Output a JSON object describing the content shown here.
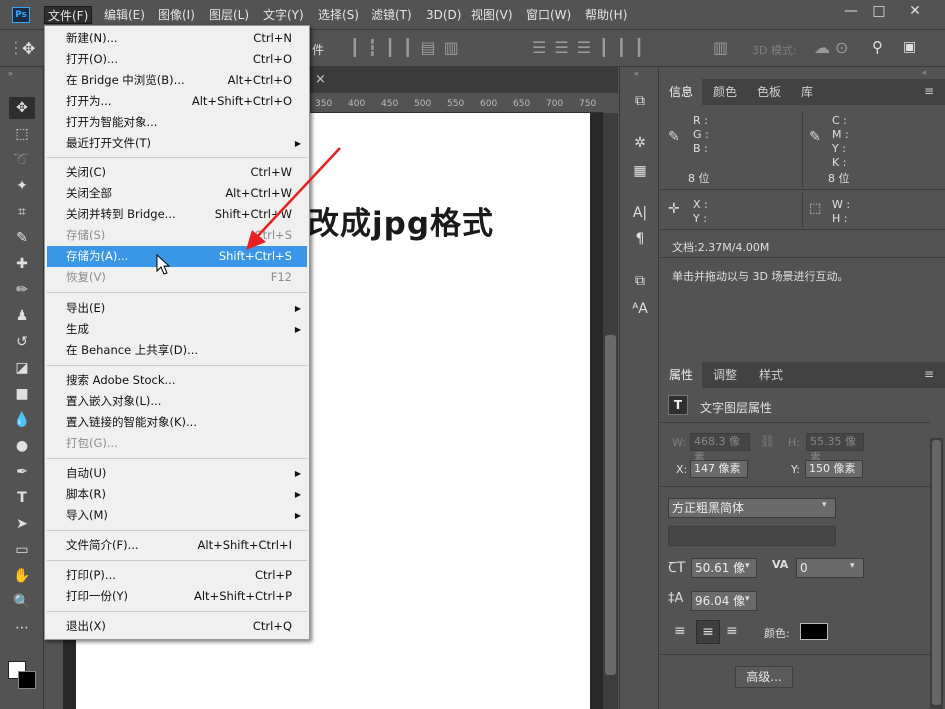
{
  "app": {
    "logo": "Ps"
  },
  "menubar": {
    "items": [
      {
        "label": "文件(F)",
        "active": true
      },
      {
        "label": "编辑(E)"
      },
      {
        "label": "图像(I)"
      },
      {
        "label": "图层(L)"
      },
      {
        "label": "文字(Y)"
      },
      {
        "label": "选择(S)"
      },
      {
        "label": "滤镜(T)"
      },
      {
        "label": "3D(D)"
      },
      {
        "label": "视图(V)"
      },
      {
        "label": "窗口(W)"
      },
      {
        "label": "帮助(H)"
      }
    ],
    "window_controls": [
      "minimize-icon",
      "maximize-icon",
      "close-icon"
    ]
  },
  "options_bar": {
    "partial_label": "件",
    "mode_label": "3D 模式:"
  },
  "document": {
    "tab_close": "×",
    "ruler_ticks": [
      "350",
      "400",
      "450",
      "500",
      "550",
      "600",
      "650",
      "700",
      "750"
    ],
    "canvas_text": "改成jpg格式"
  },
  "file_menu": {
    "items": [
      {
        "label": "新建(N)...",
        "shortcut": "Ctrl+N"
      },
      {
        "label": "打开(O)...",
        "shortcut": "Ctrl+O"
      },
      {
        "label": "在 Bridge 中浏览(B)...",
        "shortcut": "Alt+Ctrl+O"
      },
      {
        "label": "打开为...",
        "shortcut": "Alt+Shift+Ctrl+O"
      },
      {
        "label": "打开为智能对象...",
        "shortcut": ""
      },
      {
        "label": "最近打开文件(T)",
        "shortcut": "",
        "submenu": true
      },
      {
        "label": "关闭(C)",
        "shortcut": "Ctrl+W"
      },
      {
        "label": "关闭全部",
        "shortcut": "Alt+Ctrl+W"
      },
      {
        "label": "关闭并转到 Bridge...",
        "shortcut": "Shift+Ctrl+W"
      },
      {
        "label": "存储(S)",
        "shortcut": "Ctrl+S",
        "disabled": true
      },
      {
        "label": "存储为(A)...",
        "shortcut": "Shift+Ctrl+S",
        "highlighted": true
      },
      {
        "label": "恢复(V)",
        "shortcut": "F12",
        "disabled": true
      },
      {
        "label": "导出(E)",
        "shortcut": "",
        "submenu": true
      },
      {
        "label": "生成",
        "shortcut": "",
        "submenu": true
      },
      {
        "label": "在 Behance 上共享(D)...",
        "shortcut": ""
      },
      {
        "label": "搜索 Adobe Stock...",
        "shortcut": ""
      },
      {
        "label": "置入嵌入对象(L)...",
        "shortcut": ""
      },
      {
        "label": "置入链接的智能对象(K)...",
        "shortcut": ""
      },
      {
        "label": "打包(G)...",
        "shortcut": "",
        "disabled": true
      },
      {
        "label": "自动(U)",
        "shortcut": "",
        "submenu": true
      },
      {
        "label": "脚本(R)",
        "shortcut": "",
        "submenu": true
      },
      {
        "label": "导入(M)",
        "shortcut": "",
        "submenu": true
      },
      {
        "label": "文件简介(F)...",
        "shortcut": "Alt+Shift+Ctrl+I"
      },
      {
        "label": "打印(P)...",
        "shortcut": "Ctrl+P"
      },
      {
        "label": "打印一份(Y)",
        "shortcut": "Alt+Shift+Ctrl+P"
      },
      {
        "label": "退出(X)",
        "shortcut": "Ctrl+Q"
      }
    ]
  },
  "info_panel": {
    "tabs": [
      "信息",
      "颜色",
      "色板",
      "库"
    ],
    "rgb_labels": [
      "R :",
      "G :",
      "B :"
    ],
    "cmyk_labels": [
      "C :",
      "M :",
      "Y :",
      "K :"
    ],
    "bit_depth_left": "8 位",
    "bit_depth_right": "8 位",
    "xy_labels": [
      "X :",
      "Y :"
    ],
    "wh_labels": [
      "W :",
      "H :"
    ],
    "doc_size": "文档:2.37M/4.00M",
    "hint": "单击并拖动以与 3D 场景进行互动。"
  },
  "properties_panel": {
    "tabs": [
      "属性",
      "调整",
      "样式"
    ],
    "title": "文字图层属性",
    "w_label": "W:",
    "w_value": "468.3 像素",
    "h_label": "H:",
    "h_value": "55.35 像素",
    "x_label": "X:",
    "x_value": "147 像素",
    "y_label": "Y:",
    "y_value": "150 像素",
    "font_family": "方正粗黑简体",
    "font_size": "50.61 像",
    "tracking": "0",
    "leading": "96.04 像",
    "color_label": "颜色:",
    "text_color": "#000000",
    "advanced_button": "高级..."
  },
  "colors": {
    "highlight": "#3a96e7",
    "arrow": "#e8201f"
  }
}
